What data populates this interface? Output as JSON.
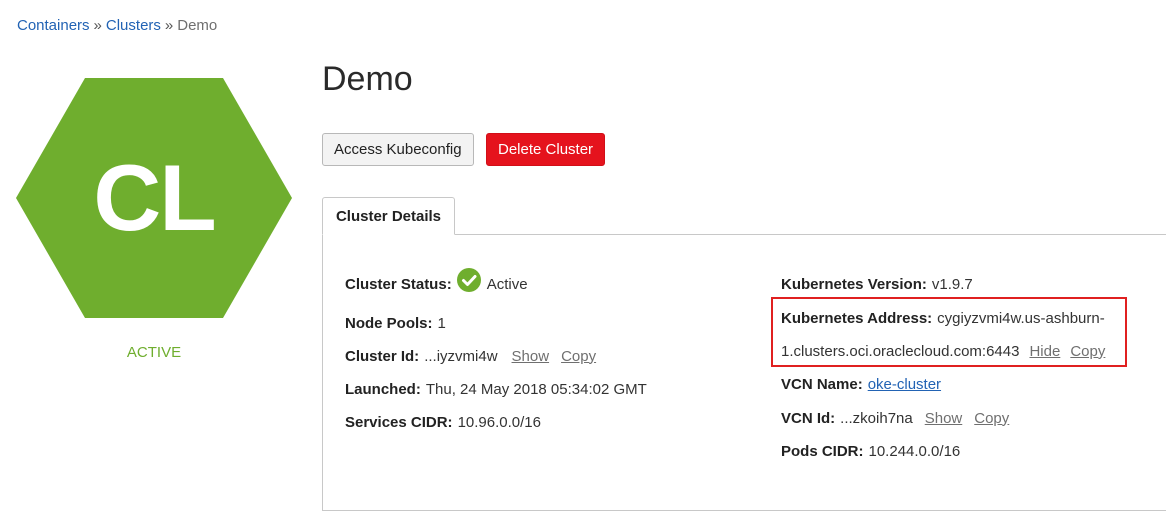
{
  "breadcrumb": {
    "items": [
      "Containers",
      "Clusters"
    ],
    "separator": "»",
    "current": "Demo"
  },
  "cluster_badge": {
    "initials": "CL",
    "state": "ACTIVE",
    "color": "#6fae2e"
  },
  "page_title": "Demo",
  "actions": {
    "access_kubeconfig": "Access Kubeconfig",
    "delete_cluster": "Delete Cluster"
  },
  "tabs": [
    {
      "label": "Cluster Details",
      "active": true
    }
  ],
  "details_left": {
    "cluster_status": {
      "label": "Cluster Status:",
      "value": "Active",
      "icon": "check-circle-icon"
    },
    "node_pools": {
      "label": "Node Pools:",
      "value": "1"
    },
    "cluster_id": {
      "label": "Cluster Id:",
      "value": "...iyzvmi4w",
      "show": "Show",
      "copy": "Copy"
    },
    "launched": {
      "label": "Launched:",
      "value": "Thu, 24 May 2018 05:34:02 GMT"
    },
    "services_cidr": {
      "label": "Services CIDR:",
      "value": "10.96.0.0/16"
    }
  },
  "details_right": {
    "kubernetes_version": {
      "label": "Kubernetes Version:",
      "value": "v1.9.7"
    },
    "kubernetes_address": {
      "label": "Kubernetes Address:",
      "value_line1": "cygiyzvmi4w.us-ashburn-",
      "value_line2": "1.clusters.oci.oraclecloud.com:6443",
      "hide": "Hide",
      "copy": "Copy"
    },
    "vcn_name": {
      "label": "VCN Name:",
      "value": "oke-cluster"
    },
    "vcn_id": {
      "label": "VCN Id:",
      "value": "...zkoih7na",
      "show": "Show",
      "copy": "Copy"
    },
    "pods_cidr": {
      "label": "Pods CIDR:",
      "value": "10.244.0.0/16"
    }
  },
  "colors": {
    "link": "#2263b4",
    "danger": "#e5131d",
    "success": "#6fae2e",
    "highlight_border": "#e02020"
  }
}
